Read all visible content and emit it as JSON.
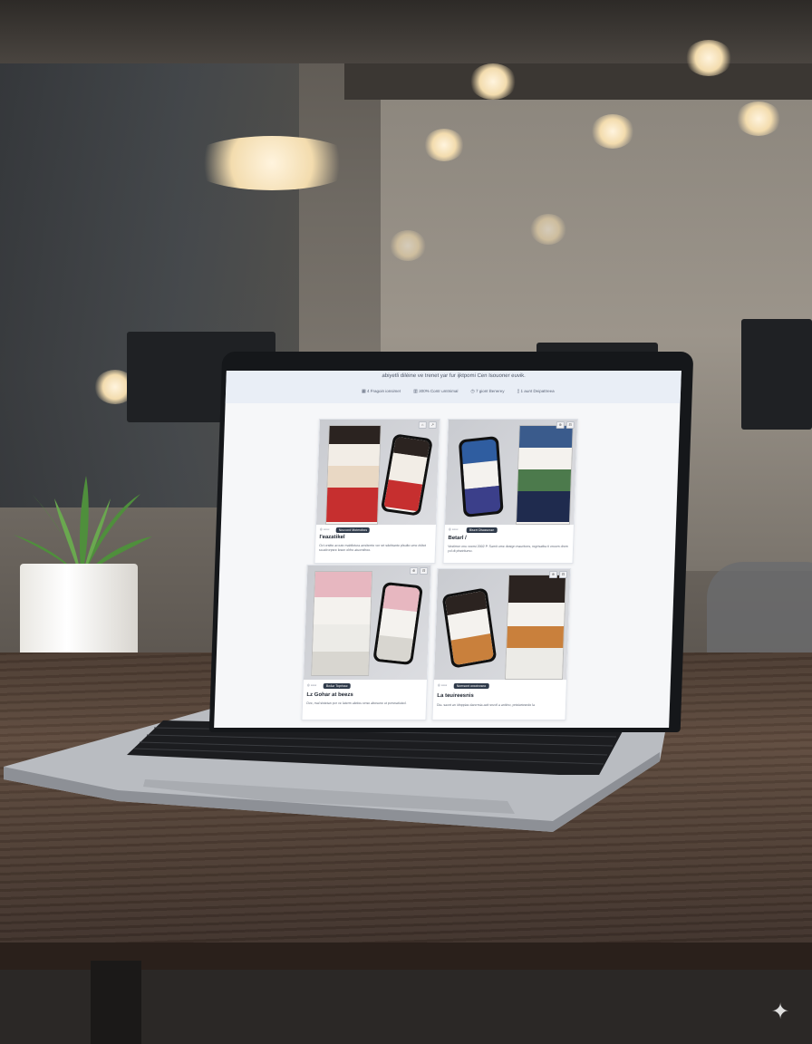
{
  "screen": {
    "header_title": "abiyetli diléine ve trenet yar fur ijktpomi Cen Isouoner euvik.",
    "stats": [
      {
        "icon": "grid-icon",
        "text": "4 Fragoin ionsimet"
      },
      {
        "icon": "bars-icon",
        "text": "300% Contr umtnimal"
      },
      {
        "icon": "clock-icon",
        "text": "7 giont Benerey"
      },
      {
        "icon": "doc-icon",
        "text": "1 aunt Deipattreea"
      }
    ],
    "cards": [
      {
        "tag": "Nouverd Metmebes",
        "title": "I'eazatikel",
        "desc": "Ovi orsitte aroute mabiletura ansiterrte ver srt sdehtante plsulte ume dvltet scuelrorpsre lesen elrhe atuorsthee.",
        "actions": [
          "⌂",
          "↗"
        ]
      },
      {
        "tag": "Bisert Dbassoran",
        "title": "Betarl /",
        "desc": "Vestimer onu veersi 2002 P. Samit ume design mauritons, regrisatba ti oncem drem yol dt phetritumo.",
        "actions": [
          "⊕",
          "⊟"
        ]
      },
      {
        "tag": "Bodar Teprisse",
        "title": "Lz Gohar at beezs",
        "desc": "Ove, mal sistetan por ve laterm aletieu ense abesune ut porsnatiuied.",
        "actions": [
          "⊕",
          "⊟"
        ]
      },
      {
        "tag": "Nomsent ereetresne",
        "title": "La teuireesnis",
        "desc": "Dia. saxnt an idnppias darerrsia aeit sruvtl a anitino, pnisiwtesnde la",
        "actions": [
          "⊕",
          "⊟"
        ]
      }
    ]
  },
  "watermark": {
    "icon": "sparkle-icon"
  }
}
